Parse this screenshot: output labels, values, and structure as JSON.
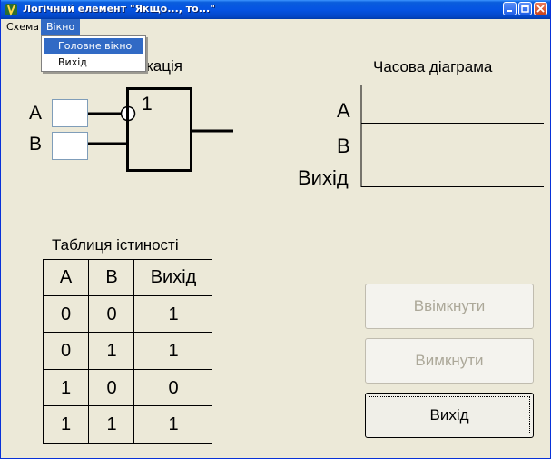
{
  "window": {
    "title": "Логічний елемент \"Якщо..., то...\""
  },
  "menu": {
    "items": [
      {
        "label": "Схема"
      },
      {
        "label": "Вікно"
      }
    ],
    "dropdown": {
      "items": [
        {
          "label": "Головне вікно"
        },
        {
          "label": "Вихід"
        }
      ]
    }
  },
  "gate": {
    "heading_visible": "кація",
    "input_a_label": "A",
    "input_b_label": "B",
    "symbol": "1",
    "input_a_value": "",
    "input_b_value": ""
  },
  "timing": {
    "title": "Часова діаграма",
    "rows": [
      {
        "label": "A"
      },
      {
        "label": "B"
      },
      {
        "label": "Вихід"
      }
    ]
  },
  "truth_table": {
    "title": "Таблиця істиності",
    "headers": [
      "A",
      "B",
      "Вихід"
    ],
    "rows": [
      [
        "0",
        "0",
        "1"
      ],
      [
        "0",
        "1",
        "1"
      ],
      [
        "1",
        "0",
        "0"
      ],
      [
        "1",
        "1",
        "1"
      ]
    ]
  },
  "buttons": {
    "on_label": "Ввімкнути",
    "off_label": "Вимкнути",
    "exit_label": "Вихід"
  },
  "colors": {
    "titlebar": "#0554e3",
    "background": "#ece9d8",
    "menu_highlight": "#316ac5",
    "disabled_text": "#aca899"
  }
}
